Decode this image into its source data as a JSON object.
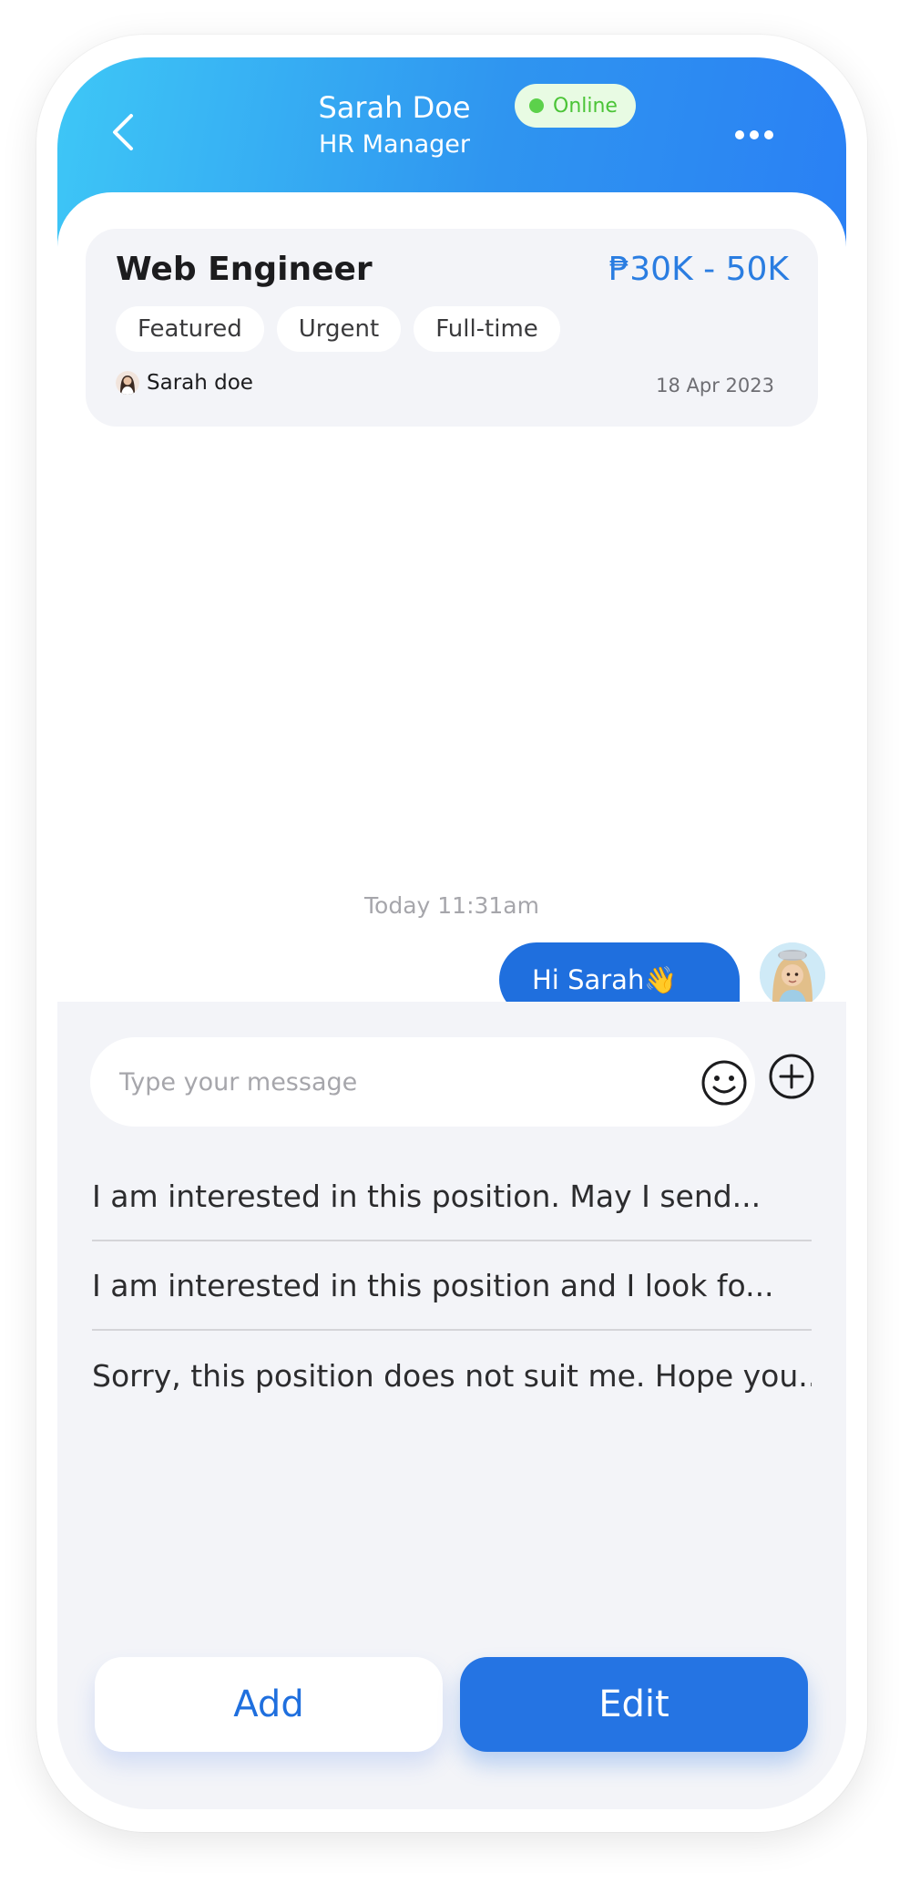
{
  "header": {
    "contact_name": "Sarah Doe",
    "contact_role": "HR Manager",
    "status": "Online",
    "icons": {
      "back": "chevron-left-icon",
      "menu": "more-horizontal-icon"
    }
  },
  "job_card": {
    "title": "Web Engineer",
    "salary": "₱30K - 50K",
    "tags": [
      "Featured",
      "Urgent",
      "Full-time"
    ],
    "poster_name": "Sarah doe",
    "posted_date": "18 Apr 2023"
  },
  "chat": {
    "timestamp": "Today 11:31am",
    "messages": [
      {
        "sender": "me",
        "text": "Hi Sarah👋"
      }
    ]
  },
  "composer": {
    "placeholder": "Type your message",
    "value": "",
    "icons": {
      "emoji": "smiley-icon",
      "attach": "plus-circle-icon"
    }
  },
  "quick_replies": [
    "I am interested in this position. May I send...",
    "I am interested in this position and I look fo...",
    "Sorry, this position does not suit me. Hope you.."
  ],
  "actions": {
    "add_label": "Add",
    "edit_label": "Edit"
  },
  "colors": {
    "header_gradient_start": "#3ec7f6",
    "header_gradient_end": "#2a80f4",
    "accent_blue": "#1f6fde",
    "online_green": "#4bc437",
    "panel_bg": "#f3f4f8"
  }
}
